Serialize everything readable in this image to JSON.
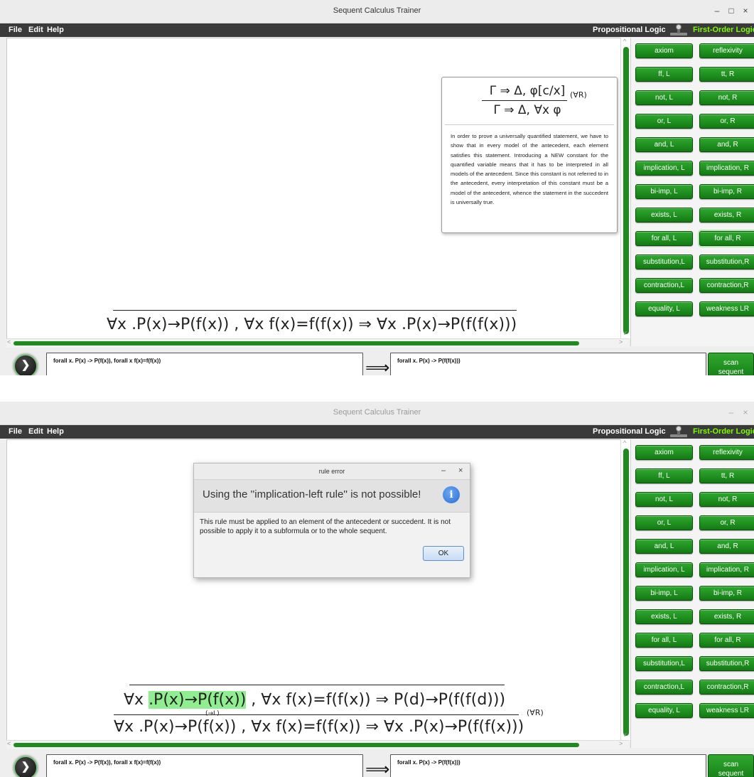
{
  "app_title": "Sequent Calculus Trainer",
  "window_controls": {
    "minimize": "–",
    "maximize": "□",
    "close": "×"
  },
  "menu": {
    "file": "File",
    "edit": "Edit",
    "help": "Help"
  },
  "logic_switch": {
    "propositional": "Propositional Logic",
    "first_order": "First-Order Logic",
    "selected": "First-Order Logic"
  },
  "rule_buttons": [
    "axiom",
    "reflexivity",
    "ff, L",
    "tt, R",
    "not, L",
    "not, R",
    "or, L",
    "or, R",
    "and, L",
    "and, R",
    "implication, L",
    "implication, R",
    "bi-imp, L",
    "bi-imp, R",
    "exists, L",
    "exists, R",
    "for all, L",
    "for all, R",
    "substitution,L",
    "substitution,R",
    "contraction,L",
    "contraction,R",
    "equality, L",
    "weakness LR"
  ],
  "screen1": {
    "tooltip": {
      "numerator": "Γ ⇒ Δ, φ[c/x]",
      "denominator": "Γ ⇒ Δ, ∀x φ",
      "rule_name": "(∀R)",
      "description": "In order to prove a universally quantified statement, we have to show that in every model of the antecedent, each element satisfies this statement. Introducing a NEW constant for the quantified variable means that it has to be interpreted in all models of the antecedent. Since this constant is not referred to in the antecedent, every interpretation of this constant must be a model of the antecedent, whence the statement in the succedent is universally true."
    },
    "sequent_formula": "∀x .P(x)→P(f(x)) , ∀x f(x)=f(f(x)) ⇒ ∀x .P(x)→P(f(f(x)))"
  },
  "screen2": {
    "dialog": {
      "title": "rule error",
      "header": "Using the ''implication-left rule'' is not possible!",
      "message": "This rule must be applied to an element of the antecedent or succedent. It is not possible to apply it to a subformula or to the whole sequent.",
      "ok": "OK"
    },
    "premise_prefix": "∀x ",
    "premise_highlight": ".P(x)→P(f(x))",
    "premise_rest": " , ∀x f(x)=f(f(x)) ⇒ P(d)→P(f(f(d)))",
    "sub_rule_label": "(→L)",
    "conclusion": "∀x .P(x)→P(f(x)) , ∀x f(x)=f(f(x)) ⇒ ∀x .P(x)→P(f(f(x)))",
    "applied_rule": "(∀R)"
  },
  "input": {
    "antecedent": "forall x. P(x) -> P(f(x)), forall x f(x)=f(f(x))",
    "arrow": "⟹",
    "succedent": "forall x. P(x) -> P(f(f(x)))",
    "scan_line1": "scan",
    "scan_line2": "sequent",
    "go_symbol": "❯"
  }
}
